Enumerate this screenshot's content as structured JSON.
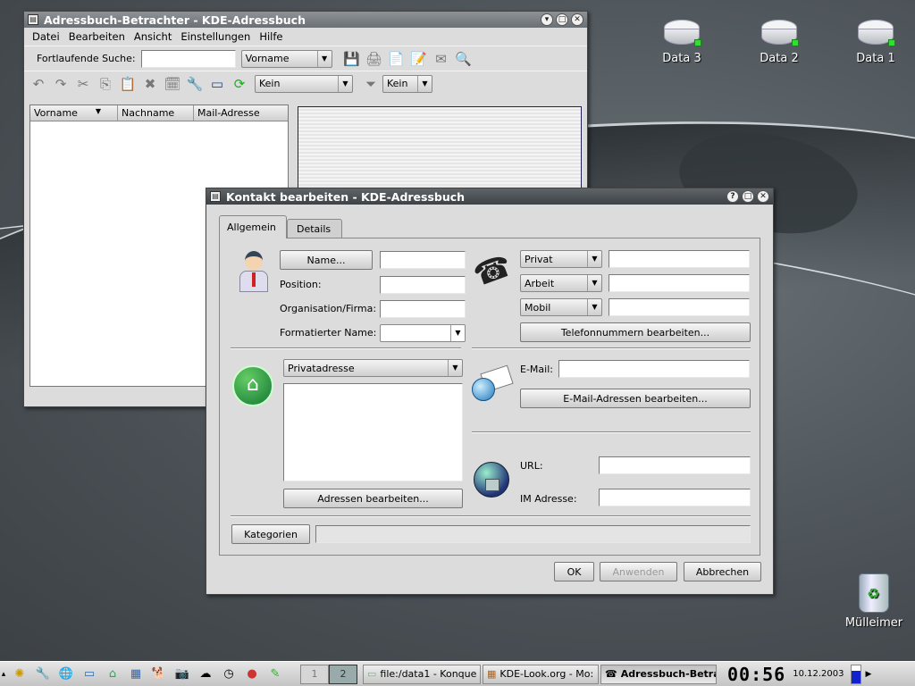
{
  "desktop": {
    "icons": [
      {
        "label": "Data 3"
      },
      {
        "label": "Data 2"
      },
      {
        "label": "Data 1"
      },
      {
        "label": "Mülleimer"
      }
    ]
  },
  "viewer": {
    "title": "Adressbuch-Betrachter - KDE-Adressbuch",
    "menu": [
      "Datei",
      "Bearbeiten",
      "Ansicht",
      "Einstellungen",
      "Hilfe"
    ],
    "search_label": "Fortlaufende Suche:",
    "search_value": "",
    "search_field": "Vorname",
    "filter_kein": "Kein",
    "filter_kein2": "Kein",
    "columns": [
      "Vorname",
      "Nachname",
      "Mail-Adresse"
    ]
  },
  "editor": {
    "title": "Kontakt bearbeiten - KDE-Adressbuch",
    "tabs": [
      "Allgemein",
      "Details"
    ],
    "name_button": "Name...",
    "position_label": "Position:",
    "org_label": "Organisation/Firma:",
    "formatted_label": "Formatierter Name:",
    "phones": [
      {
        "type": "Privat",
        "value": ""
      },
      {
        "type": "Arbeit",
        "value": ""
      },
      {
        "type": "Mobil",
        "value": ""
      }
    ],
    "edit_phones_button": "Telefonnummern bearbeiten...",
    "address_type": "Privatadresse",
    "edit_address_button": "Adressen bearbeiten...",
    "email_label": "E-Mail:",
    "edit_email_button": "E-Mail-Adressen bearbeiten...",
    "url_label": "URL:",
    "im_label": "IM Adresse:",
    "categories_button": "Kategorien",
    "ok_button": "OK",
    "apply_button": "Anwenden",
    "cancel_button": "Abbrechen"
  },
  "taskbar": {
    "desktops": [
      "1",
      "2"
    ],
    "tasks": [
      "file:/data1 - Konque",
      "KDE-Look.org - Mo:",
      "Adressbuch-Betrac"
    ],
    "clock": "00:56",
    "date": "10.12.2003"
  }
}
